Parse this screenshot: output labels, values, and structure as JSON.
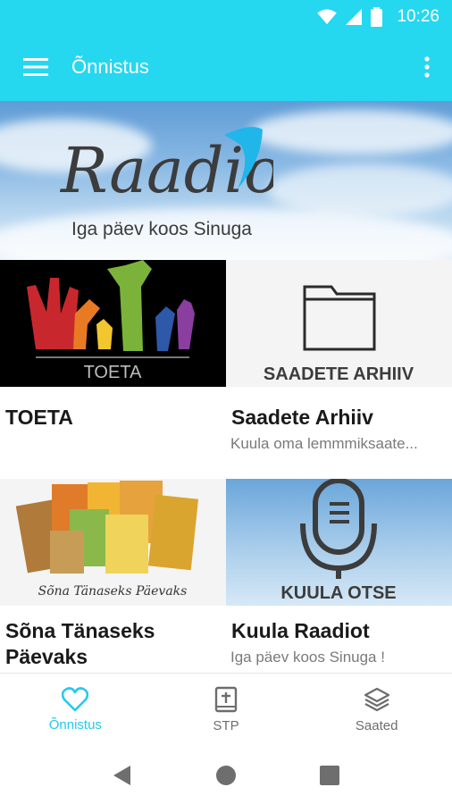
{
  "status_bar": {
    "time": "10:26",
    "icons": [
      "wifi-icon",
      "signal-icon",
      "battery-icon"
    ]
  },
  "app_bar": {
    "title": "Õnnistus",
    "menu_icon": "hamburger-menu-icon",
    "more_icon": "more-vertical-icon"
  },
  "banner": {
    "logo_text": "Raadio",
    "tagline": "Iga päev koos Sinuga"
  },
  "cards": [
    {
      "image_caption": "TOETA",
      "title": "TOETA",
      "subtitle": ""
    },
    {
      "image_caption": "SAADETE ARHIIV",
      "title": "Saadete Arhiiv",
      "subtitle": "Kuula oma lemmmiksaate..."
    },
    {
      "image_caption": "Sõna Tänaseks Päevaks",
      "title": "Sõna Tänaseks Päevaks",
      "subtitle": ""
    },
    {
      "image_caption": "KUULA OTSE",
      "title": "Kuula Raadiot",
      "subtitle": "Iga päev koos Sinuga !"
    }
  ],
  "bottom_nav": [
    {
      "label": "Õnnistus",
      "icon": "heart-icon",
      "active": true
    },
    {
      "label": "STP",
      "icon": "bible-icon",
      "active": false
    },
    {
      "label": "Saated",
      "icon": "layers-icon",
      "active": false
    }
  ],
  "colors": {
    "primary": "#26d7f0",
    "active_nav": "#26c9ea",
    "text_dark": "#1a1a1a",
    "text_muted": "#7a7a7a"
  }
}
